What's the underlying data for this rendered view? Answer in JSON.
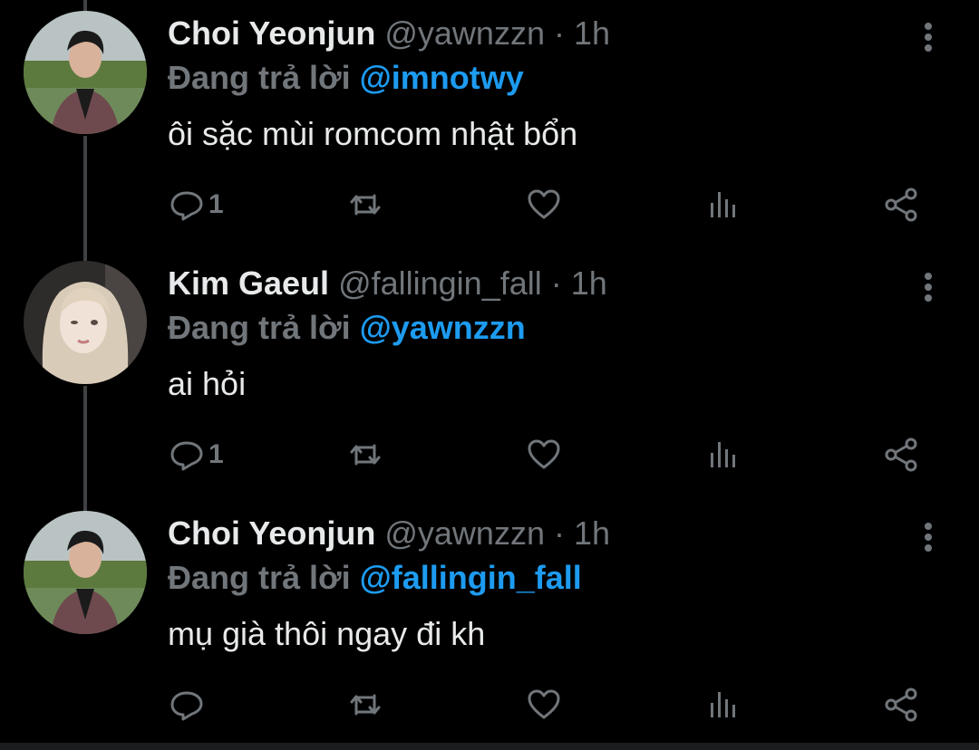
{
  "colors": {
    "background": "#000000",
    "text": "#e7e9ea",
    "muted": "#71767b",
    "mention": "#1d9bf0",
    "thread_line": "#3e4144"
  },
  "tweets": [
    {
      "name": "Choi Yeonjun",
      "handle": "@yawnzzn",
      "dot": "·",
      "time": "1h",
      "replying_prefix": "Đang trả lời",
      "replying_to": "@imnotwy",
      "text": "ôi sặc mùi romcom nhật bổn",
      "reply_count": "1",
      "avatar": "avatar-yeonjun"
    },
    {
      "name": "Kim Gaeul",
      "handle": "@fallingin_fall",
      "dot": "·",
      "time": "1h",
      "replying_prefix": "Đang trả lời",
      "replying_to": "@yawnzzn",
      "text": "ai hỏi",
      "reply_count": "1",
      "avatar": "avatar-gaeul"
    },
    {
      "name": "Choi Yeonjun",
      "handle": "@yawnzzn",
      "dot": "·",
      "time": "1h",
      "replying_prefix": "Đang trả lời",
      "replying_to": "@fallingin_fall",
      "text": "mụ già thôi ngay đi kh",
      "reply_count": "",
      "avatar": "avatar-yeonjun"
    }
  ],
  "icons": [
    "reply-icon",
    "retweet-icon",
    "like-icon",
    "views-icon",
    "share-icon",
    "more-options-icon"
  ]
}
